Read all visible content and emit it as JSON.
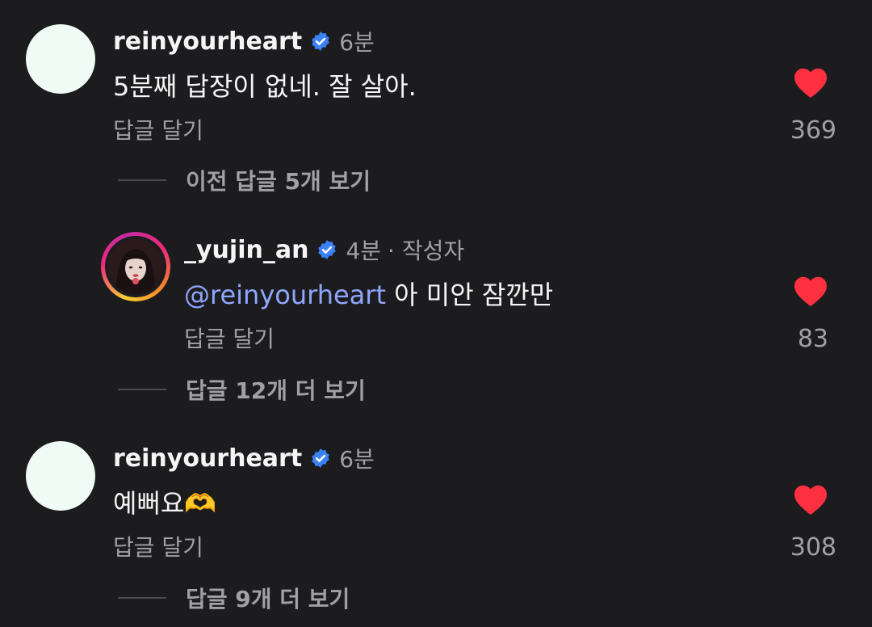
{
  "comments": [
    {
      "username": "reinyourheart",
      "time": "6분",
      "text": "5분째 답장이 없네. 잘 살아.",
      "reply_label": "답글 달기",
      "likes": "369",
      "more_label": "이전 답글 5개 보기"
    },
    {
      "username": "_yujin_an",
      "time": "4분",
      "author_tag": "· 작성자",
      "mention": "@reinyourheart",
      "text": "아 미안 잠깐만",
      "reply_label": "답글 달기",
      "likes": "83",
      "more_label": "답글 12개 더 보기"
    },
    {
      "username": "reinyourheart",
      "time": "6분",
      "text": "예뻐요",
      "emoji": "🫶",
      "reply_label": "답글 달기",
      "likes": "308",
      "more_label": "답글 9개 더 보기"
    }
  ],
  "colors": {
    "background": "#1c1c1e",
    "verified": "#3b82f6",
    "heart": "#ff3040",
    "mention": "#8fa6ff"
  }
}
